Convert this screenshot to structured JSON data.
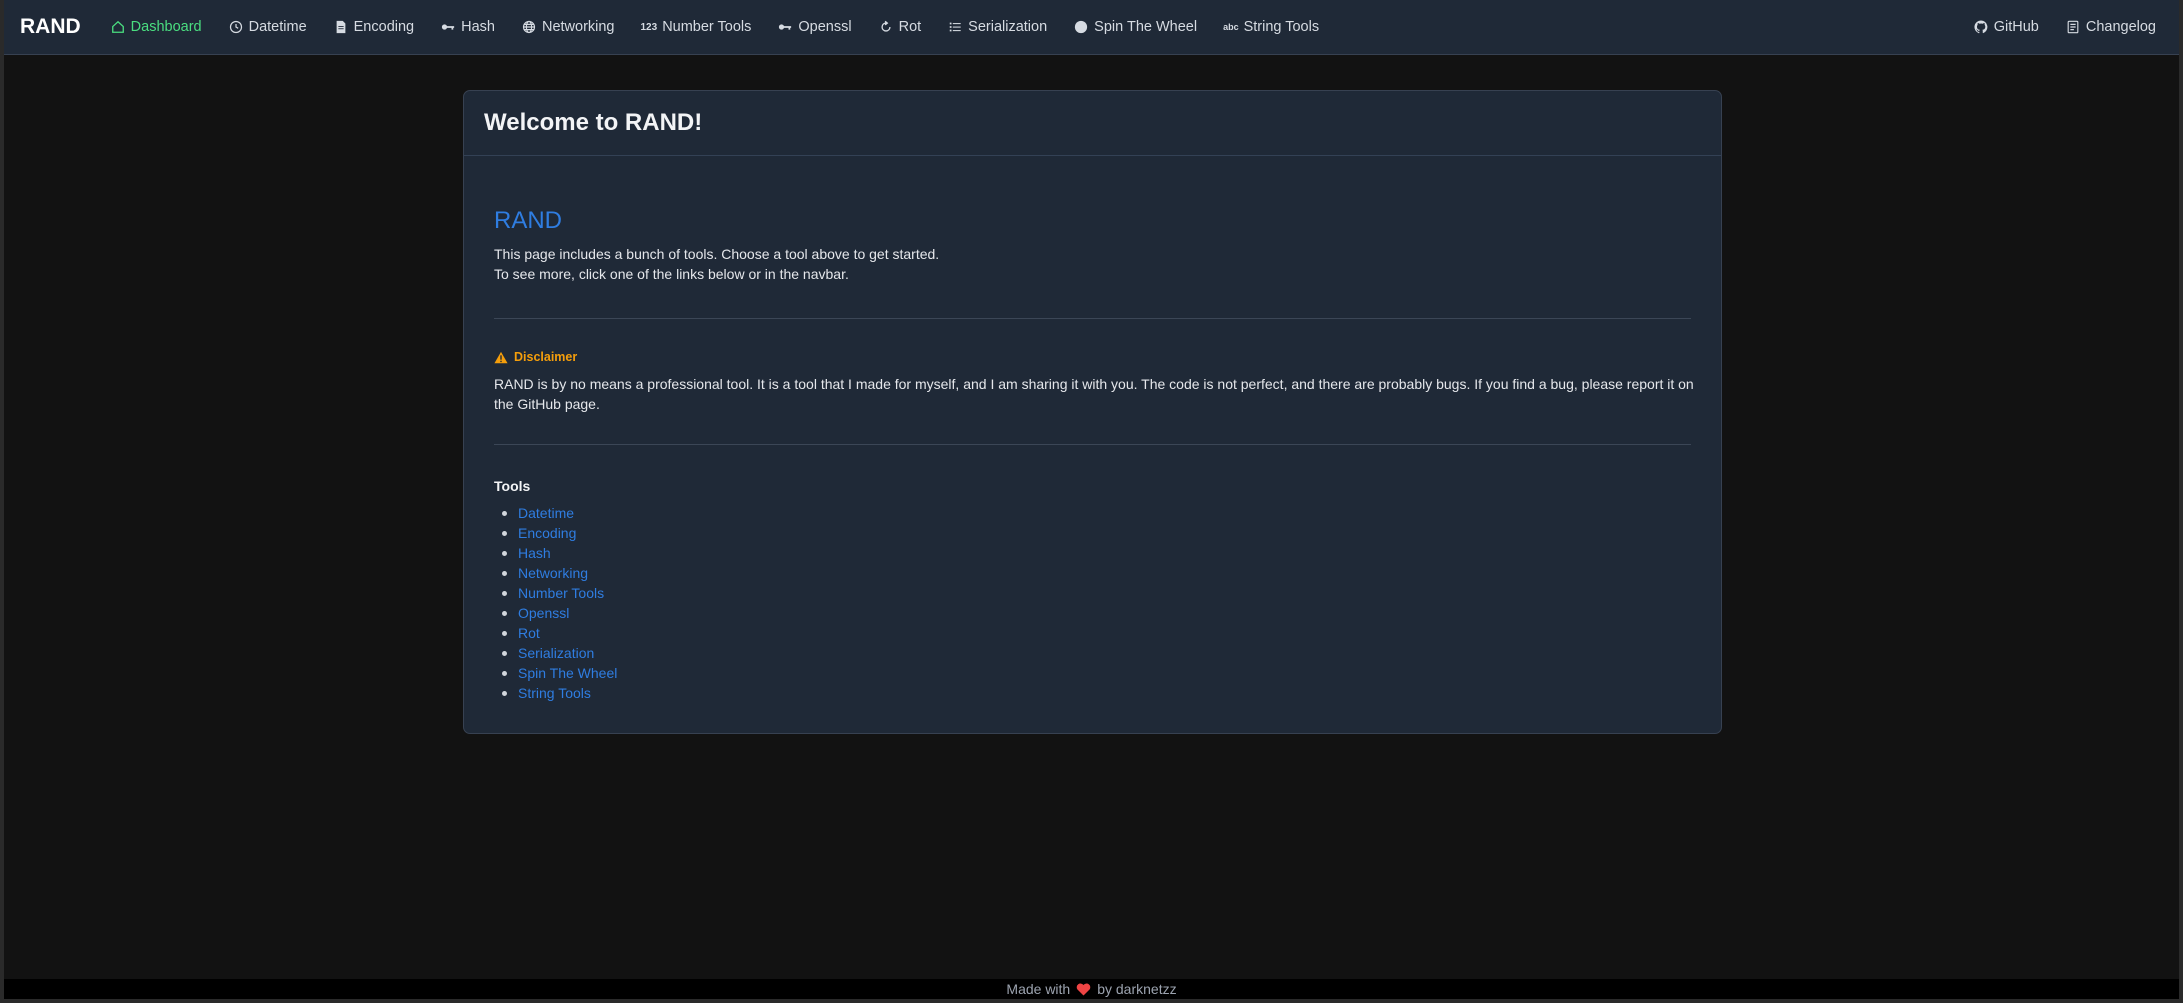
{
  "brand": "RAND",
  "nav": {
    "items": [
      {
        "label": "Dashboard",
        "icon": "home-icon",
        "active": true
      },
      {
        "label": "Datetime",
        "icon": "clock-icon"
      },
      {
        "label": "Encoding",
        "icon": "file-icon"
      },
      {
        "label": "Hash",
        "icon": "key-icon"
      },
      {
        "label": "Networking",
        "icon": "globe-icon"
      },
      {
        "label": "Number Tools",
        "icon": "numbers-icon",
        "icon_text": "123"
      },
      {
        "label": "Openssl",
        "icon": "key-icon"
      },
      {
        "label": "Rot",
        "icon": "rotate-icon"
      },
      {
        "label": "Serialization",
        "icon": "list-icon"
      },
      {
        "label": "Spin The Wheel",
        "icon": "circle-icon"
      },
      {
        "label": "String Tools",
        "icon": "abc-icon",
        "icon_text": "abc"
      }
    ],
    "right": [
      {
        "label": "GitHub",
        "icon": "github-icon"
      },
      {
        "label": "Changelog",
        "icon": "changelog-icon"
      }
    ]
  },
  "card": {
    "title": "Welcome to RAND!",
    "heading": "RAND",
    "intro_line1": "This page includes a bunch of tools. Choose a tool above to get started.",
    "intro_line2": "To see more, click one of the links below or in the navbar.",
    "disclaimer_title": "Disclaimer",
    "disclaimer_text": "RAND is by no means a professional tool. It is a tool that I made for myself, and I am sharing it with you. The code is not perfect, and there are probably bugs. If you find a bug, please report it on the GitHub page.",
    "tools_title": "Tools",
    "tools": [
      "Datetime",
      "Encoding",
      "Hash",
      "Networking",
      "Number Tools",
      "Openssl",
      "Rot",
      "Serialization",
      "Spin The Wheel",
      "String Tools"
    ]
  },
  "footer": {
    "prefix": "Made with",
    "suffix": "by darknetzz"
  },
  "colors": {
    "navbar_bg": "#1f2937",
    "page_bg": "#121212",
    "active_nav": "#4ade80",
    "link": "#2f7de1",
    "warning": "#f59e0b",
    "heart": "#ef4444"
  }
}
